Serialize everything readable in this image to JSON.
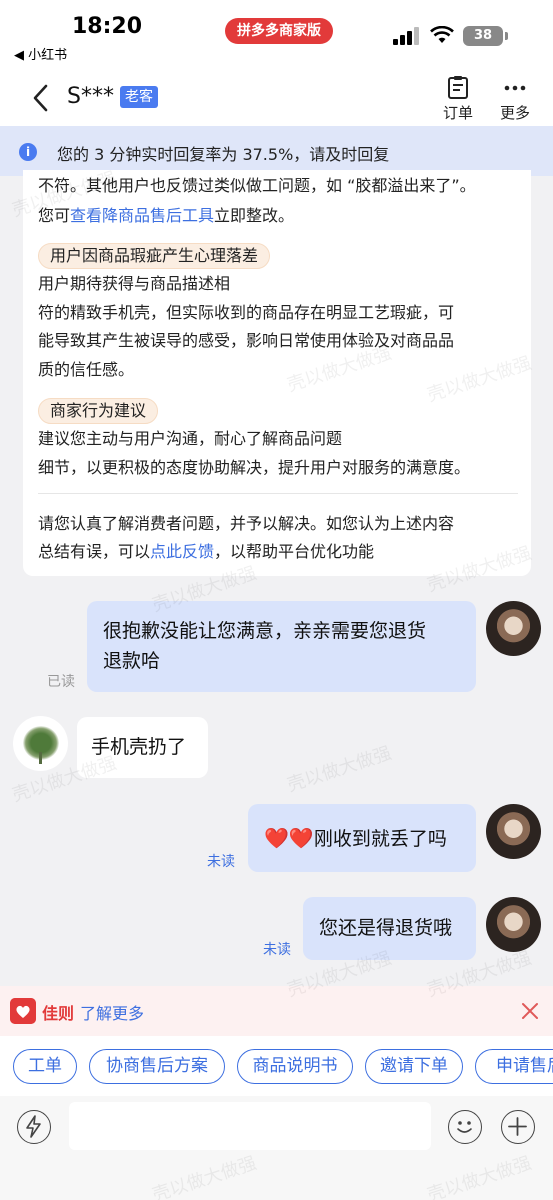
{
  "status_bar": {
    "time": "18:20",
    "back_app": "◀ 小红书",
    "app_pill": "拼多多商家版",
    "battery": "38"
  },
  "header": {
    "name": "S***",
    "tag": "老客",
    "order_label": "订单",
    "more_label": "更多"
  },
  "notice": {
    "text": "您的 3 分钟实时回复率为 37.5%，请及时回复"
  },
  "card": {
    "intro_line1": "不符。其他用户也反馈过类似做工问题，如 “胶都溢出来了”。",
    "intro_prefix": "您可",
    "intro_link": "查看降商品售后工具",
    "intro_suffix": "立即整改。",
    "section1_title": "用户因商品瑕疵产生心理落差",
    "section1_lines": [
      "用户期待获得与商品描述相",
      "符的精致手机壳，但实际收到的商品存在明显工艺瑕疵，可",
      "能导致其产生被误导的感受，影响日常使用体验及对商品品",
      "质的信任感。"
    ],
    "section2_title": "商家行为建议",
    "section2_lines": [
      "建议您主动与用户沟通，耐心了解商品问题",
      "细节，以更积极的态度协助解决，提升用户对服务的满意度。"
    ],
    "footer_line1": "请您认真了解消费者问题，并予以解决。如您认为上述内容",
    "footer_prefix": "总结有误，可以",
    "footer_link": "点此反馈",
    "footer_suffix": "，以帮助平台优化功能"
  },
  "messages": [
    {
      "from": "seller",
      "lines": [
        "很抱歉没能让您满意，亲亲需要您退货",
        "退款哈"
      ],
      "status": "已读"
    },
    {
      "from": "buyer",
      "text": "手机壳扔了"
    },
    {
      "from": "seller",
      "prefix_emoji": "❤️❤️",
      "text": "刚收到就丢了吗",
      "status": "未读"
    },
    {
      "from": "seller",
      "text": "您还是得退货哦",
      "status": "未读"
    }
  ],
  "tip_bar": {
    "brand": "佳则",
    "link": "了解更多"
  },
  "quick_actions": [
    "工单",
    "协商售后方案",
    "商品说明书",
    "邀请下单",
    "申请售后"
  ],
  "watermark": "壳以做大做强",
  "colors": {
    "accent_blue": "#3d6fe0",
    "brand_red": "#e23a3a",
    "notice_bg": "#dfe6f9",
    "bubble_out": "#d9e3fb",
    "chip_bg": "#fbeee2"
  }
}
